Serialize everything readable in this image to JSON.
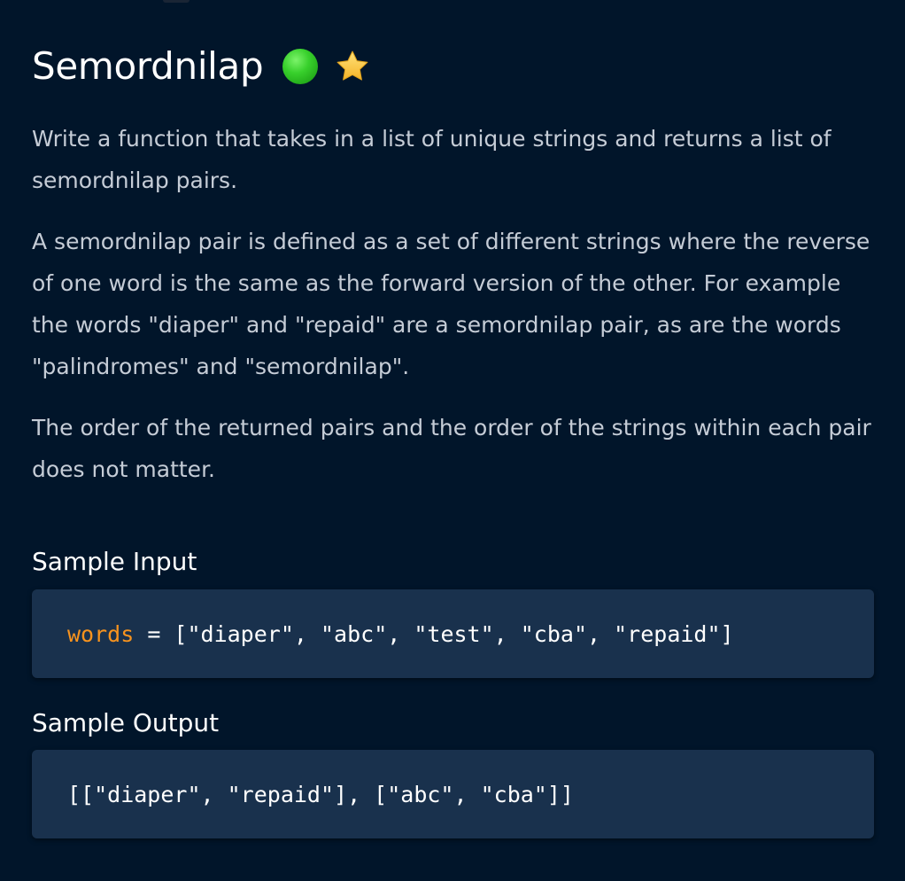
{
  "problem": {
    "title": "Semordnilap",
    "difficulty_color": "#2fc423",
    "star_color": "#f7c948",
    "paragraphs": [
      "Write a function that takes in a list of unique strings and returns a list of semordnilap pairs.",
      "A semordnilap pair is defined as a set of different strings where the reverse of one word is the same as the forward version of the other. For example the words \"diaper\" and \"repaid\" are a semordnilap pair, as are the words \"palindromes\" and \"semordnilap\".",
      "The order of the returned pairs and the order of the strings within each pair does not matter."
    ]
  },
  "sample_input": {
    "label": "Sample Input",
    "variable": "words",
    "rest": " = [\"diaper\", \"abc\", \"test\", \"cba\", \"repaid\"]"
  },
  "sample_output": {
    "label": "Sample Output",
    "code": "[[\"diaper\", \"repaid\"], [\"abc\", \"cba\"]]"
  },
  "colors": {
    "background": "#01152a",
    "code_background": "#19314d",
    "keyword": "#f7931e"
  }
}
